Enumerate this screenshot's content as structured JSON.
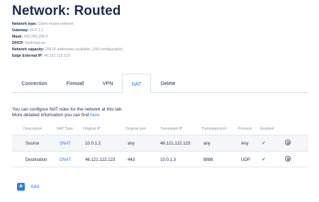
{
  "page": {
    "title": "Network: Routed"
  },
  "info": [
    {
      "label": "Network type:",
      "value": "Client routed network"
    },
    {
      "label": "Gateway:",
      "value": "10.0.1.1"
    },
    {
      "label": "Mask:",
      "value": "255.255.255.0"
    },
    {
      "label": "DHCP:",
      "value": "Switched on"
    },
    {
      "label": "Network capacity:",
      "value": "256 IP addresses available, (253 configurable)"
    },
    {
      "label": "Edge External IP:",
      "value": "46.121.122.123"
    }
  ],
  "tabs": [
    {
      "label": "Connection"
    },
    {
      "label": "Firewall"
    },
    {
      "label": "VPN"
    },
    {
      "label": "NAT",
      "active": true
    },
    {
      "label": "Delete"
    }
  ],
  "description": {
    "line1": "You can configure NAT rules for the network at this tab.",
    "line2_prefix": "More detailed information you can find ",
    "link": "here",
    "line2_suffix": "."
  },
  "table": {
    "columns": [
      "Description",
      "NAT Type",
      "Original IP",
      "Original port",
      "Translated IP",
      "Translated port",
      "Protocol",
      "Enabled"
    ],
    "rows": [
      {
        "description": "Source",
        "nat_type": "SNAT",
        "original_ip": "10.0.1.2",
        "original_port": "any",
        "translated_ip": "46.121.122.123",
        "translated_port": "any",
        "protocol": "Any",
        "enabled": "✔"
      },
      {
        "description": "Destination",
        "nat_type": "DNAT",
        "original_ip": "46.121.122.123",
        "original_port": "443",
        "translated_ip": "10.0.1.3",
        "translated_port": "8888",
        "protocol": "UDP",
        "enabled": "✔"
      }
    ]
  },
  "add": {
    "icon": "+",
    "label": "Add"
  },
  "colors": {
    "primary": "#2b7de9",
    "text": "#1d2b4f",
    "muted": "#8a93a6",
    "success": "#3aa655"
  }
}
